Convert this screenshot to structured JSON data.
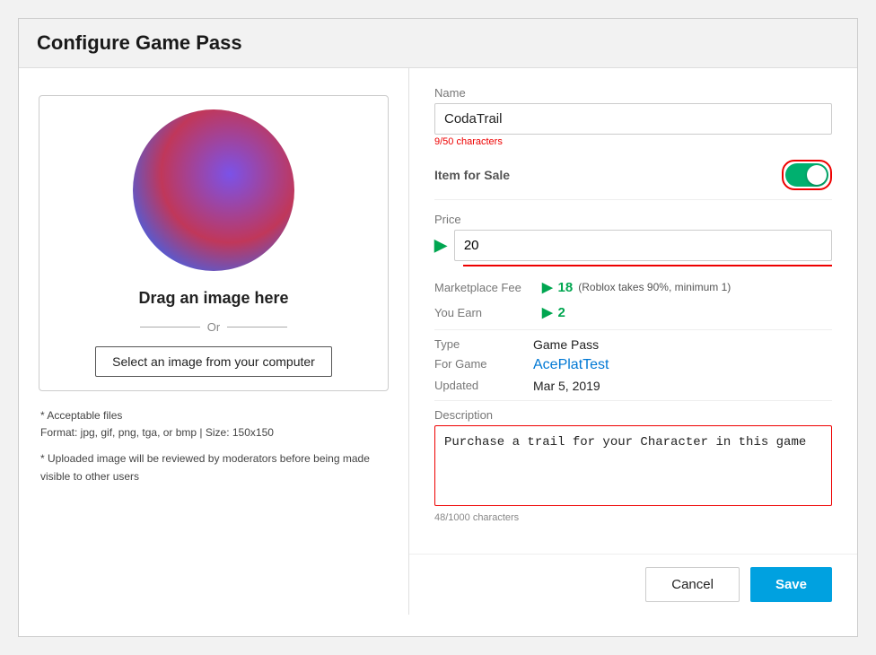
{
  "dialog": {
    "title": "Configure Game Pass"
  },
  "left": {
    "drag_text": "Drag an image here",
    "or_label": "Or",
    "select_btn": "Select an image from your computer",
    "file_info_line1": "* Acceptable files",
    "file_info_line2": "Format: jpg, gif, png, tga, or bmp | Size: 150x150",
    "moderation_note": "* Uploaded image will be reviewed by moderators before being made visible to other users"
  },
  "right": {
    "name_label": "Name",
    "name_value": "CodaTrail",
    "name_char_count": "9/50 characters",
    "sale_label": "Item for Sale",
    "price_label": "Price",
    "price_value": "20",
    "marketplace_label": "Marketplace Fee",
    "marketplace_value": "18",
    "marketplace_note": "(Roblox takes 90%, minimum 1)",
    "you_earn_label": "You Earn",
    "you_earn_value": "2",
    "type_label": "Type",
    "type_value": "Game Pass",
    "for_game_label": "For Game",
    "for_game_value": "AcePlatTest",
    "updated_label": "Updated",
    "updated_value": "Mar 5, 2019",
    "description_label": "Description",
    "description_value": "Purchase a trail for your Character in this game",
    "description_char_count": "48/1000 characters",
    "cancel_btn": "Cancel",
    "save_btn": "Save"
  }
}
